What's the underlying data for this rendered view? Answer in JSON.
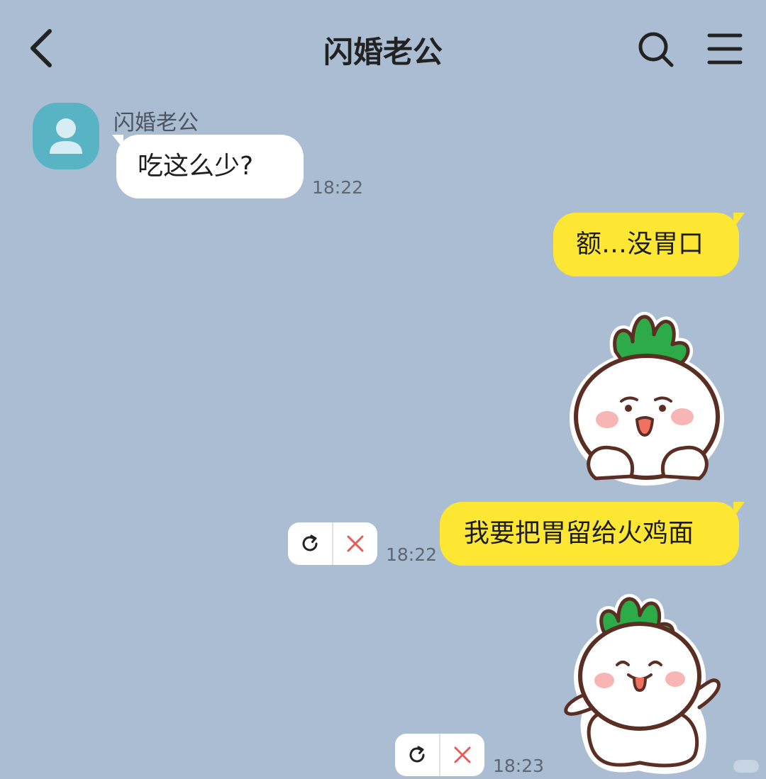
{
  "header": {
    "title": "闪婚老公",
    "back_icon": "chevron-left-icon",
    "search_icon": "search-icon",
    "menu_icon": "hamburger-menu-icon"
  },
  "colors": {
    "background": "#aabdd2",
    "incoming_bubble": "#ffffff",
    "outgoing_bubble": "#fee733",
    "avatar": "#58b3c5",
    "retry_icon": "#222222",
    "delete_icon": "#e35d5d"
  },
  "contact": {
    "name": "闪婚老公",
    "avatar_icon": "person-icon"
  },
  "messages": [
    {
      "direction": "incoming",
      "type": "text",
      "text": "吃这么少?",
      "time": "18:22"
    },
    {
      "direction": "outgoing",
      "type": "text",
      "text": "额…没胃口"
    },
    {
      "direction": "outgoing",
      "type": "sticker",
      "sticker": "radish-sticker-shy-pout"
    },
    {
      "direction": "outgoing",
      "type": "text",
      "text": "我要把胃留给火鸡面",
      "time": "18:22",
      "status": "failed",
      "actions": [
        "retry-icon",
        "delete-icon"
      ]
    },
    {
      "direction": "outgoing",
      "type": "sticker",
      "sticker": "radish-sticker-tongue-out",
      "time": "18:23",
      "status": "failed",
      "actions": [
        "retry-icon",
        "delete-icon"
      ]
    }
  ]
}
